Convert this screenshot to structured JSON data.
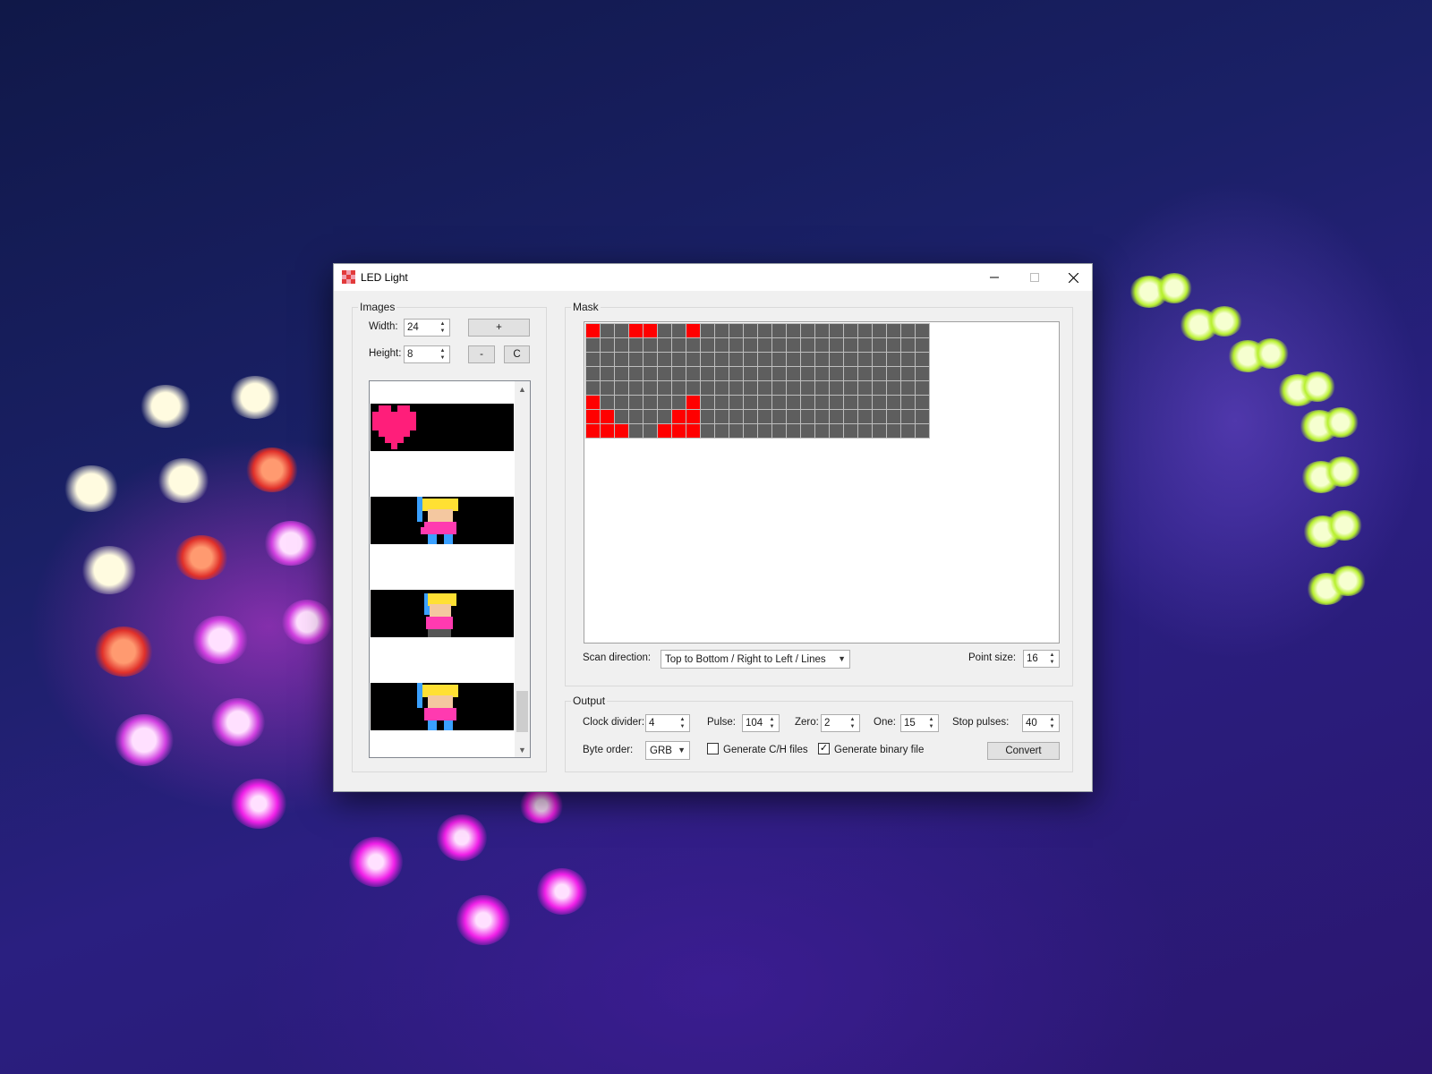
{
  "window": {
    "title": "LED Light"
  },
  "images": {
    "group_label": "Images",
    "width_label": "Width:",
    "width_value": "24",
    "height_label": "Height:",
    "height_value": "8",
    "add_label": "+",
    "remove_label": "-",
    "clear_label": "C",
    "thumbnails": [
      "heart",
      "character",
      "character",
      "character"
    ]
  },
  "mask": {
    "group_label": "Mask",
    "columns": 24,
    "rows": 8,
    "lit_cells": [
      [
        0,
        0
      ],
      [
        0,
        3
      ],
      [
        0,
        4
      ],
      [
        0,
        7
      ],
      [
        5,
        0
      ],
      [
        5,
        7
      ],
      [
        6,
        0
      ],
      [
        6,
        1
      ],
      [
        6,
        6
      ],
      [
        6,
        7
      ],
      [
        7,
        0
      ],
      [
        7,
        1
      ],
      [
        7,
        2
      ],
      [
        7,
        5
      ],
      [
        7,
        6
      ],
      [
        7,
        7
      ]
    ],
    "scan_direction_label": "Scan direction:",
    "scan_direction_value": "Top to Bottom / Right to Left / Lines",
    "point_size_label": "Point size:",
    "point_size_value": "16"
  },
  "output": {
    "group_label": "Output",
    "clock_divider_label": "Clock divider:",
    "clock_divider_value": "4",
    "pulse_label": "Pulse:",
    "pulse_value": "104",
    "zero_label": "Zero:",
    "zero_value": "2",
    "one_label": "One:",
    "one_value": "15",
    "stop_pulses_label": "Stop pulses:",
    "stop_pulses_value": "40",
    "byte_order_label": "Byte order:",
    "byte_order_value": "GRB",
    "generate_ch_label": "Generate C/H files",
    "generate_ch_checked": false,
    "generate_binary_label": "Generate binary file",
    "generate_binary_checked": true,
    "convert_label": "Convert"
  },
  "colors": {
    "lit": "#ff0000",
    "unlit": "#5e5e5e",
    "grid_line": "#bdbdbd",
    "heart": "#ff1e7a"
  }
}
